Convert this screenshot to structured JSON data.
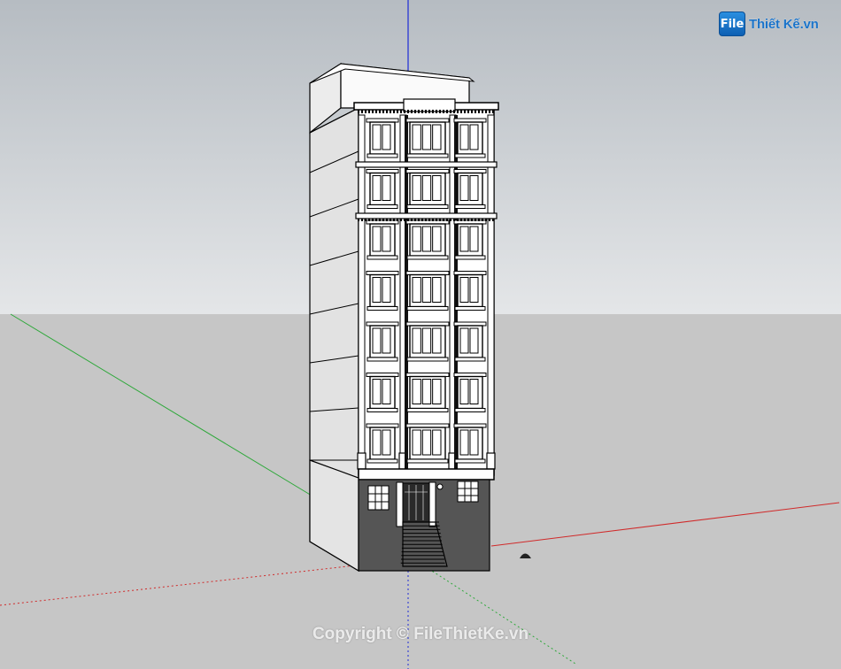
{
  "app": {
    "logo": {
      "box_text": "File",
      "rest_text": "Thiết Kế.vn"
    },
    "watermark": "Copyright © FileThietKe.vn"
  },
  "colors": {
    "sky_top": "#b6bcc2",
    "sky_bottom": "#e4e6e8",
    "ground": "#c6c6c6",
    "axis_blue": "#1d2bd6",
    "axis_red": "#d02a2a",
    "axis_green": "#2ea83a",
    "facade": "#ffffff",
    "side": "#e2e2e2",
    "ground_floor": "#555555",
    "brand_blue": "#1a73c9"
  },
  "icons": {
    "logo": "file-thietke-logo-icon"
  },
  "model": {
    "upper_floors": 7,
    "window_columns": 3
  }
}
